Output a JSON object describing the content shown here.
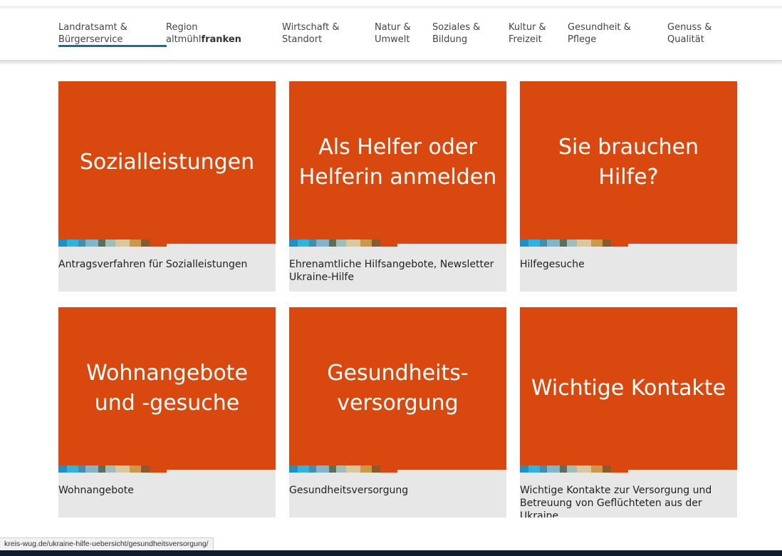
{
  "nav": {
    "items": [
      {
        "line1": "Landratsamt &",
        "line2": "Bürgerservice",
        "active": true
      },
      {
        "line1": "Region",
        "line2_normal": "altmühl",
        "line2_bold": "franken"
      },
      {
        "line1": "Wirtschaft &",
        "line2": "Standort"
      },
      {
        "line1": "Natur &",
        "line2": "Umwelt"
      },
      {
        "line1": "Soziales &",
        "line2": "Bildung"
      },
      {
        "line1": "Kultur &",
        "line2": "Freizeit"
      },
      {
        "line1": "Gesundheit &",
        "line2": "Pflege"
      },
      {
        "line1": "Genuss &",
        "line2": "Qualität"
      }
    ]
  },
  "tiles": [
    {
      "heading": "Sozialleistungen",
      "description": "Antragsverfahren für Sozialleistungen"
    },
    {
      "heading": "Als Helfer oder Helferin anmelden",
      "description": "Ehrenamtliche Hilfsangebote, Newsletter Ukraine-Hilfe"
    },
    {
      "heading": "Sie brauchen Hilfe?",
      "description": "Hilfegesuche"
    },
    {
      "heading": "Wohnangebote und -gesuche",
      "description": "Wohnangebote"
    },
    {
      "heading": "Gesundheits- versorgung",
      "description": "Gesundheitsversorgung"
    },
    {
      "heading": "Wichtige Kontakte",
      "description": "Wichtige Kontakte zur Versorgung und Betreuung von Geflüchteten aus der Ukraine"
    }
  ],
  "status_url": "kreis-wug.de/ukraine-hilfe-uebersicht/gesundheitsversorgung/",
  "colors": {
    "tile_orange": "#d9490f",
    "tile_caption_bg": "#e7e7e7",
    "nav_active_underline": "#2b6a87",
    "stripe": [
      "#1f8fc4",
      "#2fb3e3",
      "#3f8fb0",
      "#7fb6c9",
      "#5c6f5b",
      "#9fbdb9",
      "#d9c79f",
      "#c89a4a",
      "#8a5a2b",
      "#d9490f"
    ]
  }
}
